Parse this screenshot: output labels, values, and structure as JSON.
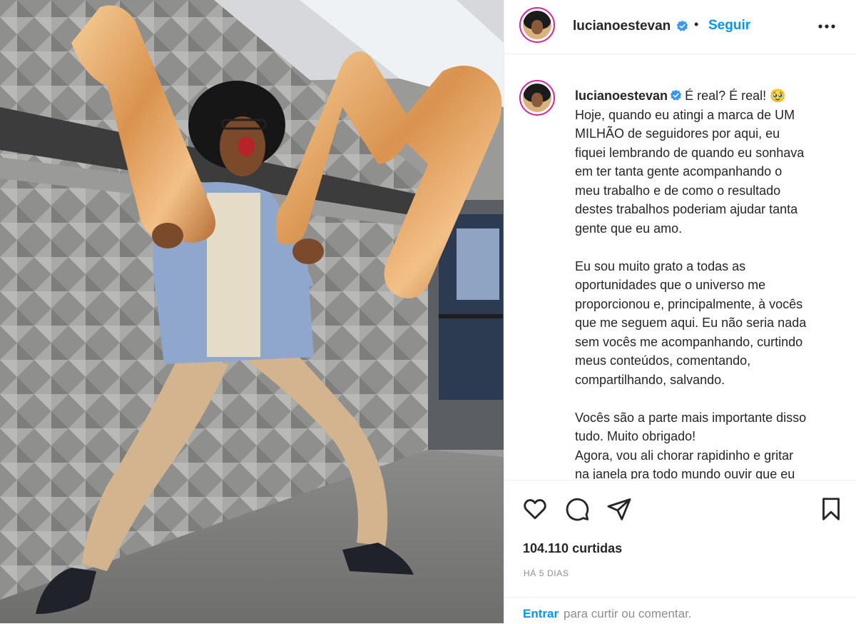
{
  "post": {
    "username": "lucianoestevan",
    "follow_label": "Seguir",
    "separator": "•",
    "caption": {
      "lines": [
        "É real? É real! 🥹",
        "Hoje, quando eu atingi a marca de UM",
        "MILHÃO de seguidores por aqui, eu",
        "fiquei lembrando de quando eu sonhava",
        "em ter tanta gente acompanhando o",
        "meu trabalho e de como o resultado",
        "destes trabalhos poderiam ajudar tanta",
        "gente que eu amo.",
        "",
        "Eu sou muito grato a todas as",
        "oportunidades que o universo me",
        "proporcionou e, principalmente, à vocês",
        "que me seguem aqui. Eu não seria nada",
        "sem vocês me acompanhando, curtindo",
        "meus conteúdos, comentando,",
        "compartilhando, salvando.",
        "",
        "Vocês são a parte mais importante disso",
        "tudo. Muito obrigado!",
        "Agora, vou ali chorar rapidinho e gritar",
        "na janela pra todo mundo ouvir que eu"
      ]
    },
    "likes": "104.110 curtidas",
    "time_ago": "HÁ 5 DIAS",
    "login_prompt": {
      "link": "Entrar",
      "rest": "para curtir ou comentar."
    },
    "photo": {
      "balloon_letters": "1M"
    }
  },
  "icons": {
    "verified": "verified-badge-icon",
    "more": "more-options-icon",
    "like": "heart-icon",
    "comment": "comment-icon",
    "share": "send-icon",
    "save": "bookmark-icon"
  },
  "colors": {
    "link_blue": "#0095f6",
    "text": "#262626",
    "muted": "#8e8e8e",
    "verified_blue": "#3897f0",
    "balloon_gold": "#e0a660"
  }
}
